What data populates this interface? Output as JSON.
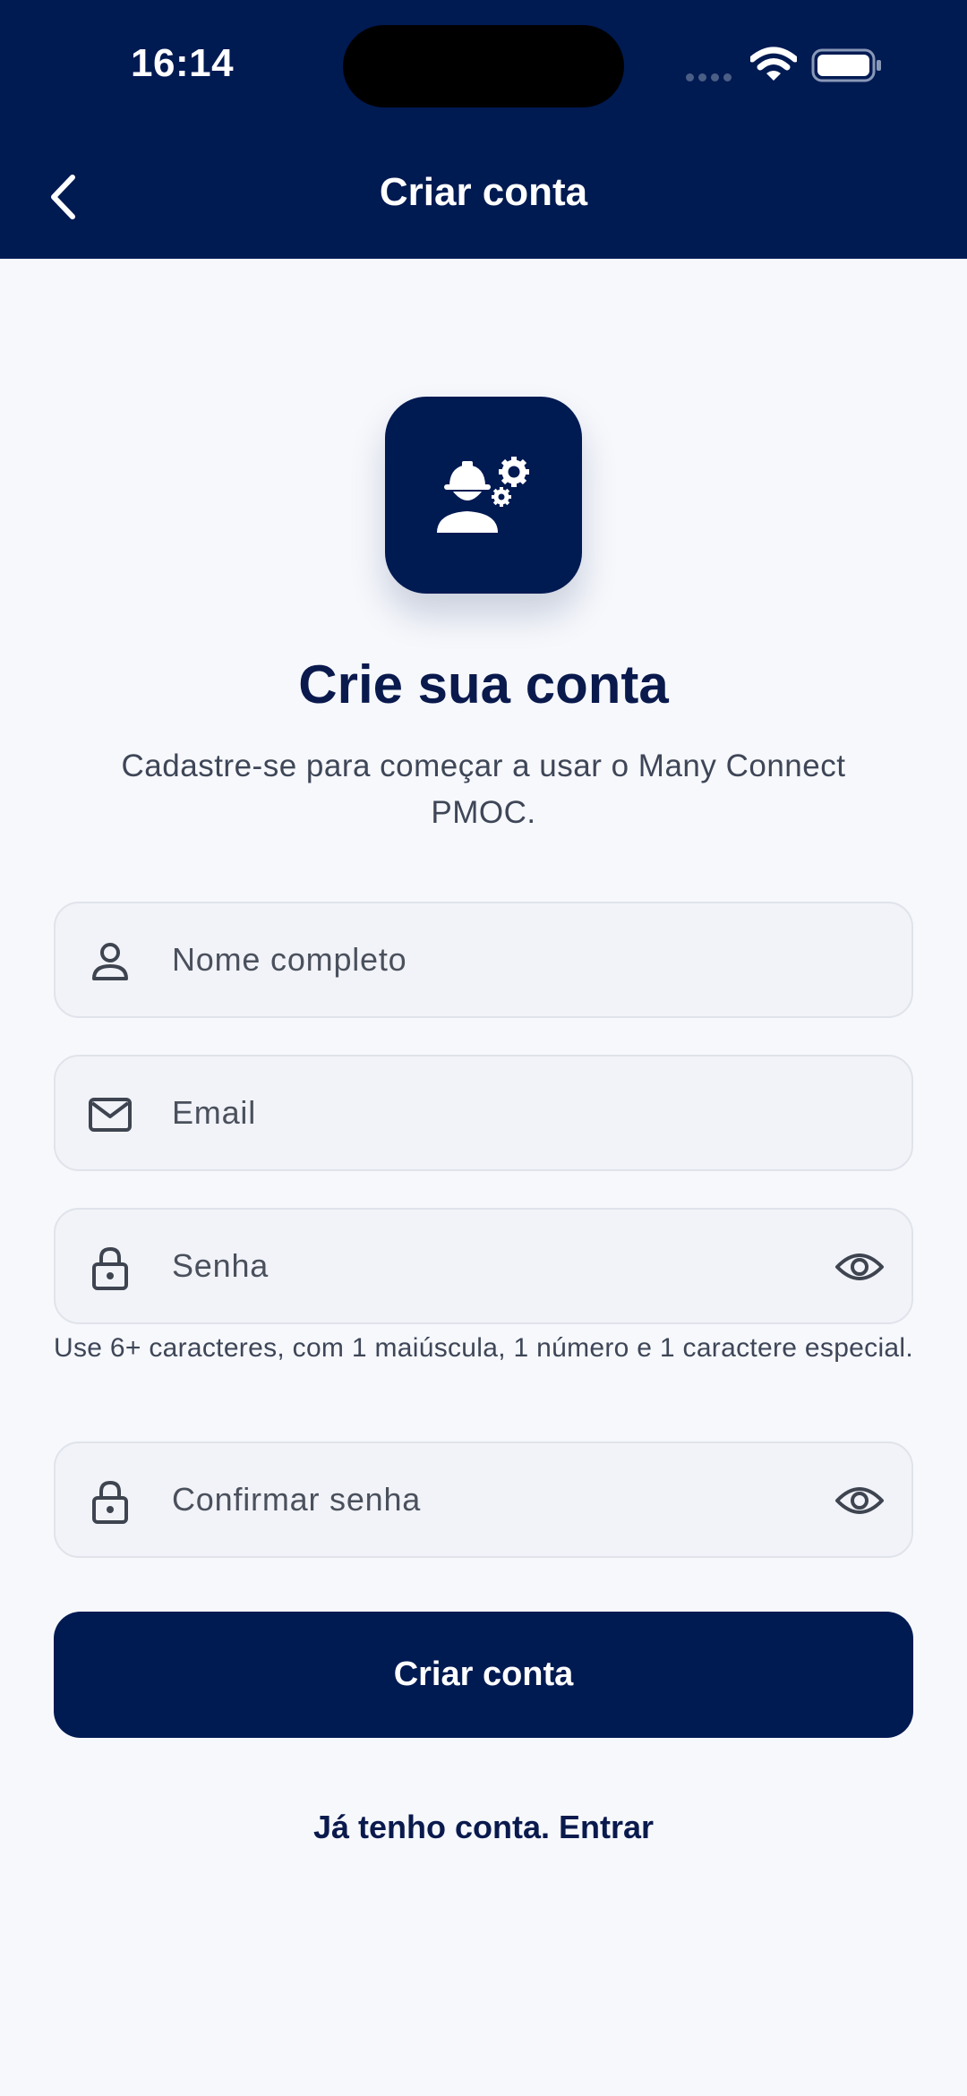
{
  "status_bar": {
    "time": "16:14",
    "icons": [
      "signal-dots-icon",
      "wifi-icon",
      "battery-icon"
    ]
  },
  "header": {
    "back_icon": "chevron-left-icon",
    "title": "Criar conta"
  },
  "logo": {
    "icon": "worker-helmet-gears-icon"
  },
  "main": {
    "heading": "Crie sua conta",
    "subtitle": "Cadastre-se para começar a usar o Many Connect PMOC."
  },
  "form": {
    "name": {
      "placeholder": "Nome completo",
      "icon": "person-icon"
    },
    "email": {
      "placeholder": "Email",
      "icon": "mail-icon"
    },
    "password": {
      "placeholder": "Senha",
      "icon": "lock-icon",
      "toggle_icon": "eye-icon"
    },
    "password_hint": "Use 6+ caracteres, com 1 maiúscula, 1 número e 1 caractere especial.",
    "confirm_password": {
      "placeholder": "Confirmar senha",
      "icon": "lock-icon",
      "toggle_icon": "eye-icon"
    },
    "submit_label": "Criar conta",
    "login_link": "Já tenho conta. Entrar"
  },
  "colors": {
    "primary": "#001A52",
    "background": "#F6F8FC",
    "field_background": "#F1F3F8",
    "field_border": "#E0E3EA"
  }
}
